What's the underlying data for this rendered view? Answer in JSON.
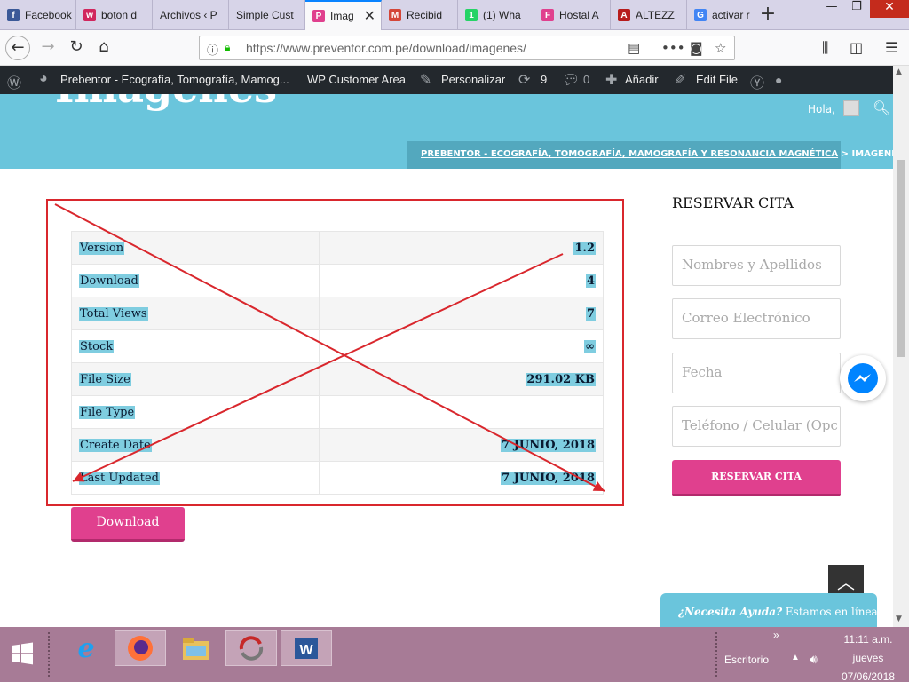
{
  "browser": {
    "tabs": [
      {
        "label": "Facebook",
        "favicon": "facebook-icon",
        "color": "#3b5998",
        "glyph": "f"
      },
      {
        "label": "boton d",
        "favicon": "wix-icon",
        "color": "#d1265d",
        "glyph": "w"
      },
      {
        "label": "Archivos ‹ P",
        "favicon": "",
        "color": "",
        "glyph": ""
      },
      {
        "label": "Simple Cust",
        "favicon": "",
        "color": "",
        "glyph": ""
      },
      {
        "label": "Imag",
        "favicon": "preventor-icon",
        "color": "#e0408e",
        "glyph": "P"
      },
      {
        "label": "Recibid",
        "favicon": "gmail-icon",
        "color": "#d44638",
        "glyph": "M"
      },
      {
        "label": "(1) Wha",
        "favicon": "whatsapp-icon",
        "color": "#25d366",
        "glyph": "1"
      },
      {
        "label": "Hostal A",
        "favicon": "hostal-icon",
        "color": "#e0408e",
        "glyph": "F"
      },
      {
        "label": "ALTEZZ",
        "favicon": "altezza-icon",
        "color": "#b71c1c",
        "glyph": "A"
      },
      {
        "label": "activar r",
        "favicon": "google-icon",
        "color": "#4285f4",
        "glyph": "G"
      }
    ],
    "url": "https://www.preventor.com.pe/download/imagenes/"
  },
  "adminbar": {
    "site": "Prebentor - Ecografía, Tomografía, Mamog...",
    "customer_area": "WP Customer Area",
    "customize": "Personalizar",
    "updates": "9",
    "comments": "0",
    "add_new": "Añadir",
    "edit_file": "Edit File"
  },
  "header": {
    "title": "Imagenes",
    "greeting": "Hola,",
    "breadcrumb_link": "PREBENTOR - ECOGRAFÍA, TOMOGRAFÍA, MAMOGRAFÍA Y RESONANCIA MAGNÉTICA",
    "breadcrumb_sep": ">",
    "breadcrumb_current": "IMAGENES"
  },
  "file_info": {
    "rows": [
      {
        "label": "Version",
        "value": "1.2"
      },
      {
        "label": "Download",
        "value": "4"
      },
      {
        "label": "Total Views",
        "value": "7"
      },
      {
        "label": "Stock",
        "value": "∞"
      },
      {
        "label": "File Size",
        "value": "291.02 KB"
      },
      {
        "label": "File Type",
        "value": ""
      },
      {
        "label": "Create Date",
        "value": "7 JUNIO, 2018"
      },
      {
        "label": "Last Updated",
        "value": "7 JUNIO, 2018"
      }
    ],
    "download_label": "Download"
  },
  "sidebar": {
    "title": "RESERVAR CITA",
    "name_placeholder": "Nombres y Apellidos",
    "email_placeholder": "Correo Electrónico",
    "date_placeholder": "Fecha",
    "phone_placeholder": "Teléfono / Celular (Opc",
    "submit_label": "RESERVAR CITA"
  },
  "help": {
    "question": "¿Necesita Ayuda?",
    "status": " Estamos en línea"
  },
  "taskbar": {
    "desktop_label": "Escritorio",
    "time": "11:11 a.m.",
    "day": "jueves",
    "date": "07/06/2018"
  },
  "colors": {
    "accent": "#e0408e",
    "header": "#6ac5dc",
    "annotation": "#d9272d"
  }
}
